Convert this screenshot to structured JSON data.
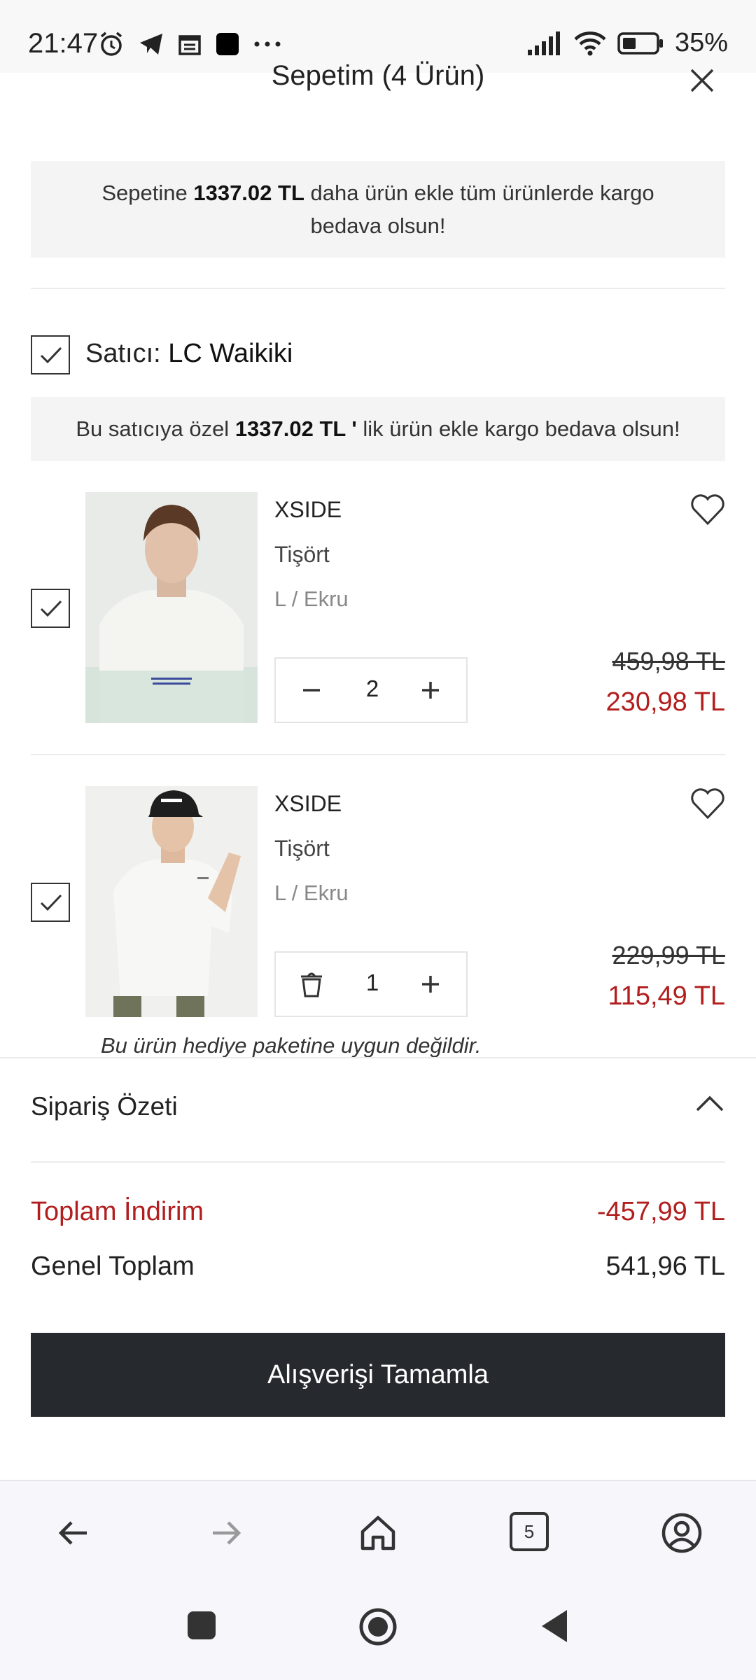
{
  "status_bar": {
    "time": "21:47",
    "battery": "35%",
    "icons": [
      "alarm-icon",
      "telegram-icon",
      "calendar-icon",
      "app-square-icon",
      "more-dots-icon",
      "signal-icon",
      "wifi-icon",
      "battery-icon"
    ]
  },
  "header": {
    "title": "Sepetim (4 Ürün)",
    "close_icon": "close-icon"
  },
  "shipping_banner": {
    "before": "Sepetine ",
    "amount": "1337.02 TL",
    "after": " daha ürün ekle tüm ürünlerde kargo bedava olsun!"
  },
  "seller": {
    "prefix": "Satıcı: ",
    "name": "LC Waikiki",
    "checked": true,
    "banner_before": "Bu satıcıya özel ",
    "banner_amount": "1337.02 TL '",
    "banner_after": " lik ürün ekle kargo bedava olsun!"
  },
  "products": [
    {
      "brand": "XSIDE",
      "name": "Tişört",
      "variant": "L / Ekru",
      "quantity": "2",
      "old_price": "459,98 TL",
      "new_price": "230,98 TL",
      "checked": true,
      "left_control_icon": "minus-icon"
    },
    {
      "brand": "XSIDE",
      "name": "Tişört",
      "variant": "L / Ekru",
      "quantity": "1",
      "old_price": "229,99 TL",
      "new_price": "115,49 TL",
      "checked": true,
      "left_control_icon": "trash-icon",
      "note": "Bu ürün hediye paketine uygun değildir."
    }
  ],
  "summary": {
    "title": "Sipariş Özeti",
    "discount_label": "Toplam İndirim",
    "discount_value": "-457,99 TL",
    "total_label": "Genel Toplam",
    "total_value": "541,96 TL",
    "checkout_label": "Alışverişi Tamamla"
  },
  "browser_bar": {
    "tab_count": "5"
  },
  "colors": {
    "accent_red": "#b21e1e",
    "checkout_bg": "#26292d"
  }
}
